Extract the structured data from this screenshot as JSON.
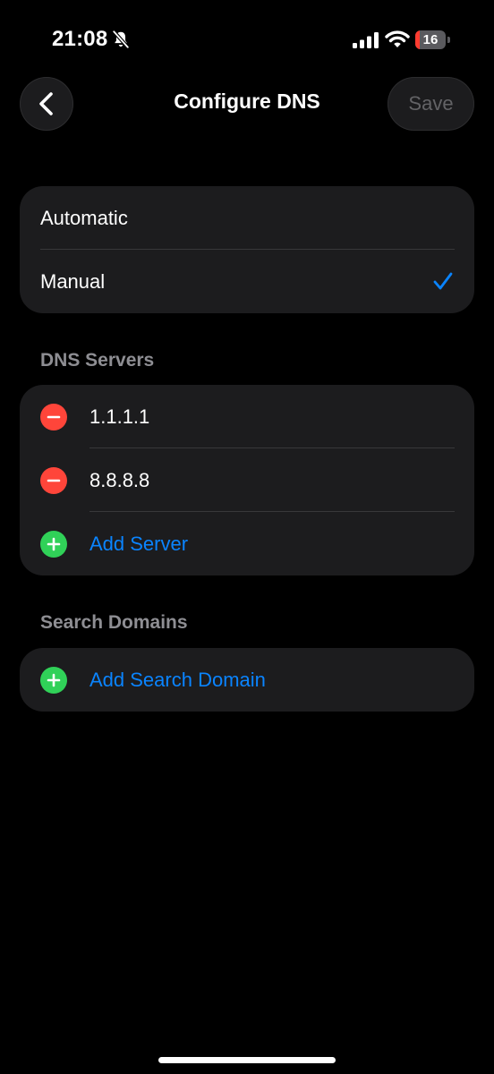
{
  "status_bar": {
    "time": "21:08",
    "battery_level": "16",
    "battery_fraction": 0.16,
    "icons": [
      "bell-slash-icon",
      "signal-icon",
      "wifi-icon",
      "battery-icon"
    ]
  },
  "nav": {
    "back_icon": "chevron-left-icon",
    "title": "Configure DNS",
    "save_label": "Save"
  },
  "mode": {
    "options": [
      {
        "label": "Automatic",
        "selected": false
      },
      {
        "label": "Manual",
        "selected": true
      }
    ]
  },
  "dns_servers": {
    "header": "DNS Servers",
    "servers": [
      "1.1.1.1",
      "8.8.8.8"
    ],
    "add_label": "Add Server"
  },
  "search_domains": {
    "header": "Search Domains",
    "add_label": "Add Search Domain"
  },
  "colors": {
    "accent": "#0a84ff",
    "remove": "#ff453a",
    "add": "#30d158",
    "group_background": "#1c1c1e",
    "background": "#000000"
  }
}
